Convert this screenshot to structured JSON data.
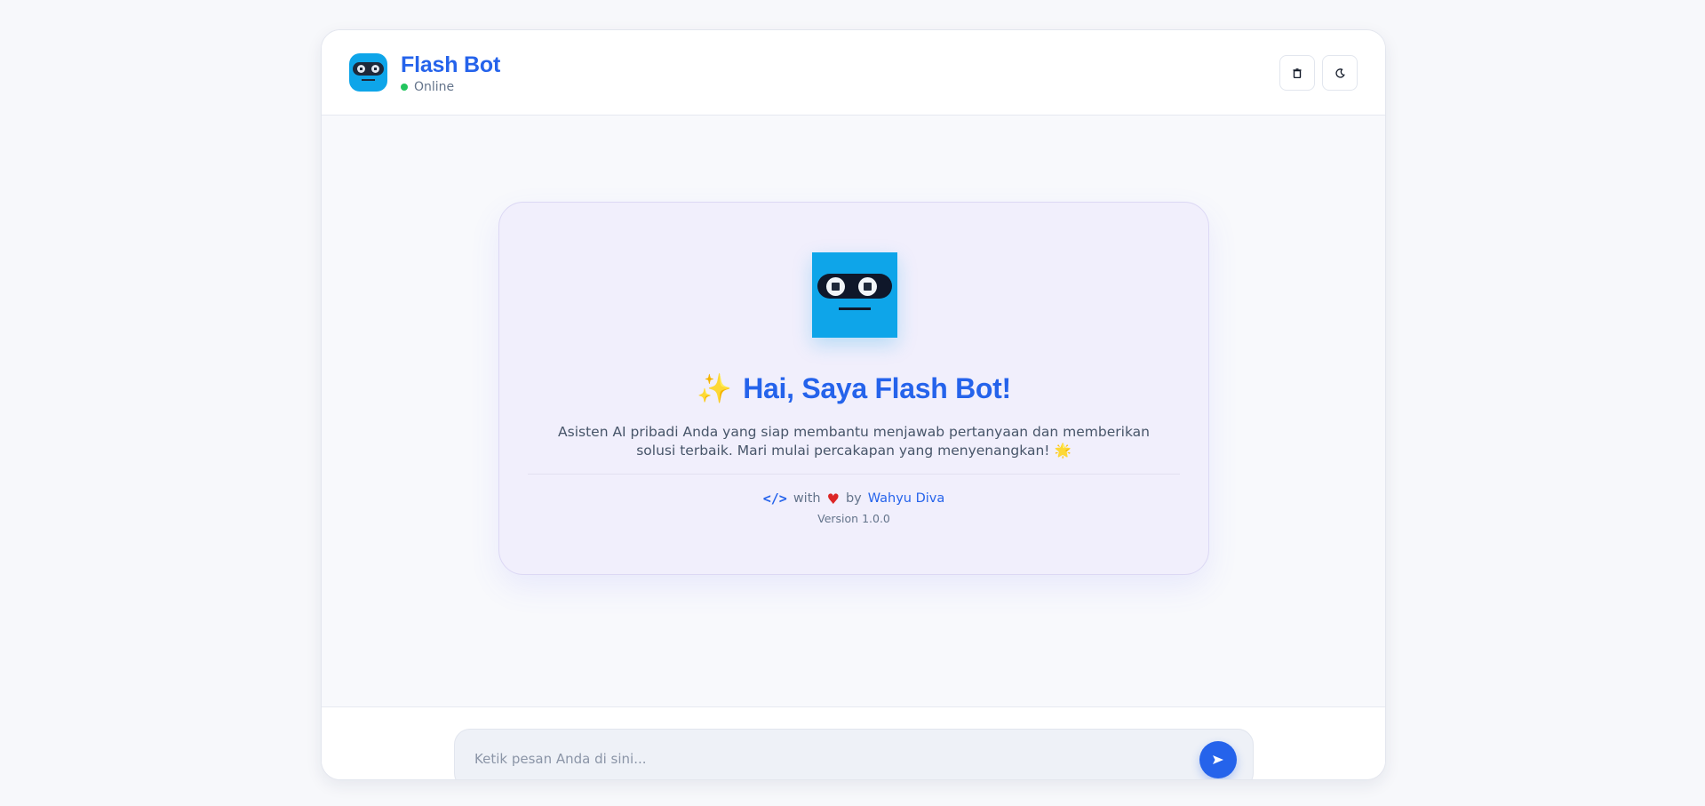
{
  "header": {
    "title": "Flash Bot",
    "status": "Online",
    "status_color": "#22c55e",
    "buttons": [
      {
        "icon": "trash-icon"
      },
      {
        "icon": "moon-icon"
      }
    ]
  },
  "welcome": {
    "sparkle": "✨",
    "title": "Hai, Saya Flash Bot!",
    "description": "Asisten AI pribadi Anda yang siap membantu menjawab pertanyaan dan memberikan solusi terbaik. Mari mulai percakapan yang menyenangkan!",
    "sun": "🌟",
    "credit": {
      "code_glyph": "</>",
      "with": "with",
      "heart": "♥",
      "by": "by",
      "author": "Wahyu Diva"
    },
    "version": "Version 1.0.0"
  },
  "composer": {
    "placeholder": "Ketik pesan Anda di sini...",
    "send_icon": "send-icon"
  },
  "colors": {
    "accent": "#2563eb",
    "bot": "#0ea5e9",
    "card_bg": "#f1effc"
  }
}
